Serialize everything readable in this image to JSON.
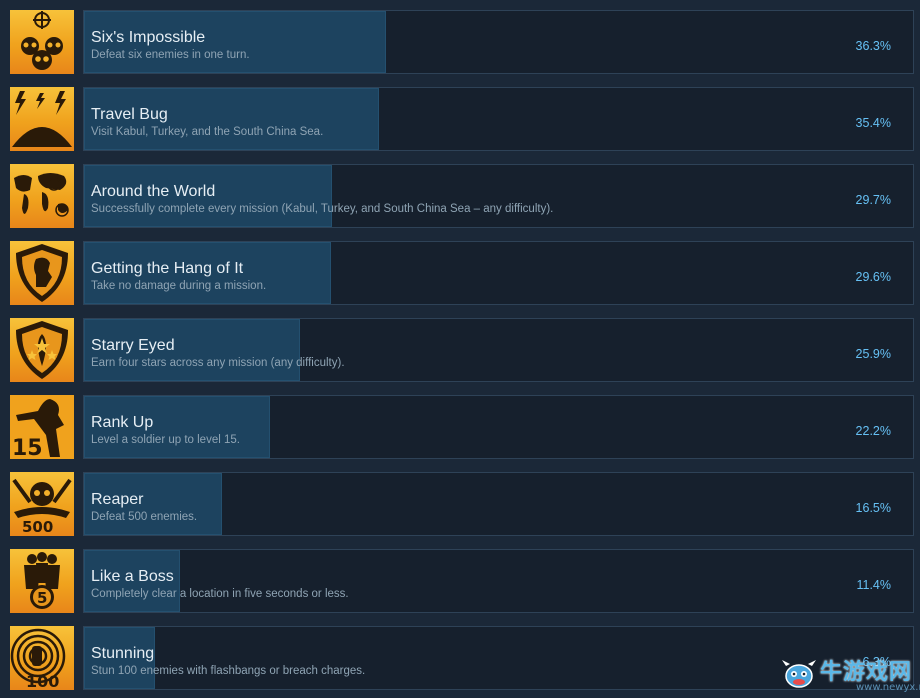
{
  "achievements": [
    {
      "title": "Six's Impossible",
      "desc": "Defeat six enemies in one turn.",
      "pct": "36.3%",
      "fraction": 0.363,
      "icon": "skulls-icon"
    },
    {
      "title": "Travel Bug",
      "desc": "Visit Kabul, Turkey, and the South China Sea.",
      "pct": "35.4%",
      "fraction": 0.354,
      "icon": "globe-lightning-icon"
    },
    {
      "title": "Around the World",
      "desc": "Successfully complete every mission (Kabul, Turkey, and South China Sea – any difficulty).",
      "pct": "29.7%",
      "fraction": 0.297,
      "icon": "world-map-icon"
    },
    {
      "title": "Getting the Hang of It",
      "desc": "Take no damage during a mission.",
      "pct": "29.6%",
      "fraction": 0.296,
      "icon": "shield-soldier-icon"
    },
    {
      "title": "Starry Eyed",
      "desc": "Earn four stars across any mission (any difficulty).",
      "pct": "25.9%",
      "fraction": 0.259,
      "icon": "shield-stars-icon"
    },
    {
      "title": "Rank Up",
      "desc": "Level a soldier up to level 15.",
      "pct": "22.2%",
      "fraction": 0.222,
      "icon": "rank-15-icon"
    },
    {
      "title": "Reaper",
      "desc": "Defeat 500 enemies.",
      "pct": "16.5%",
      "fraction": 0.165,
      "icon": "skull-500-icon"
    },
    {
      "title": "Like a Boss",
      "desc": "Completely clear a location in five seconds or less.",
      "pct": "11.4%",
      "fraction": 0.114,
      "icon": "squad-5-icon"
    },
    {
      "title": "Stunning",
      "desc": "Stun 100 enemies with flashbangs or breach charges.",
      "pct": "6.3%",
      "fraction": 0.083,
      "icon": "flashbang-100-icon"
    }
  ],
  "watermark": {
    "brand": "牛游戏网",
    "url": "www.newyx.net"
  },
  "colors": {
    "bar": "#1d435f",
    "percent": "#66c0f4",
    "icon_bg": "#f0a21d",
    "page_bg": "#1b2838"
  }
}
